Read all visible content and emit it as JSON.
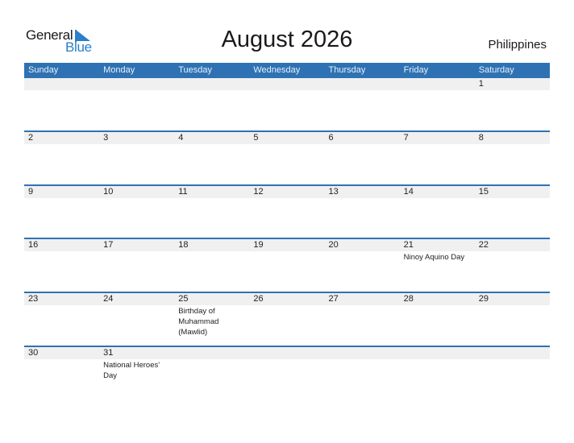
{
  "logo": {
    "line1": "General",
    "line2": "Blue"
  },
  "title": "August 2026",
  "country": "Philippines",
  "colors": {
    "header": "#2e72b3",
    "accent": "#2a7fc9",
    "band": "#f0f0f0"
  },
  "weekdays": [
    "Sunday",
    "Monday",
    "Tuesday",
    "Wednesday",
    "Thursday",
    "Friday",
    "Saturday"
  ],
  "weeks": [
    [
      {
        "day": ""
      },
      {
        "day": ""
      },
      {
        "day": ""
      },
      {
        "day": ""
      },
      {
        "day": ""
      },
      {
        "day": ""
      },
      {
        "day": "1"
      }
    ],
    [
      {
        "day": "2"
      },
      {
        "day": "3"
      },
      {
        "day": "4"
      },
      {
        "day": "5"
      },
      {
        "day": "6"
      },
      {
        "day": "7"
      },
      {
        "day": "8"
      }
    ],
    [
      {
        "day": "9"
      },
      {
        "day": "10"
      },
      {
        "day": "11"
      },
      {
        "day": "12"
      },
      {
        "day": "13"
      },
      {
        "day": "14"
      },
      {
        "day": "15"
      }
    ],
    [
      {
        "day": "16"
      },
      {
        "day": "17"
      },
      {
        "day": "18"
      },
      {
        "day": "19"
      },
      {
        "day": "20"
      },
      {
        "day": "21",
        "event": "Ninoy Aquino Day"
      },
      {
        "day": "22"
      }
    ],
    [
      {
        "day": "23"
      },
      {
        "day": "24"
      },
      {
        "day": "25",
        "event": "Birthday of Muhammad (Mawlid)"
      },
      {
        "day": "26"
      },
      {
        "day": "27"
      },
      {
        "day": "28"
      },
      {
        "day": "29"
      }
    ],
    [
      {
        "day": "30"
      },
      {
        "day": "31",
        "event": "National Heroes' Day"
      },
      {
        "day": ""
      },
      {
        "day": ""
      },
      {
        "day": ""
      },
      {
        "day": ""
      },
      {
        "day": ""
      }
    ]
  ]
}
